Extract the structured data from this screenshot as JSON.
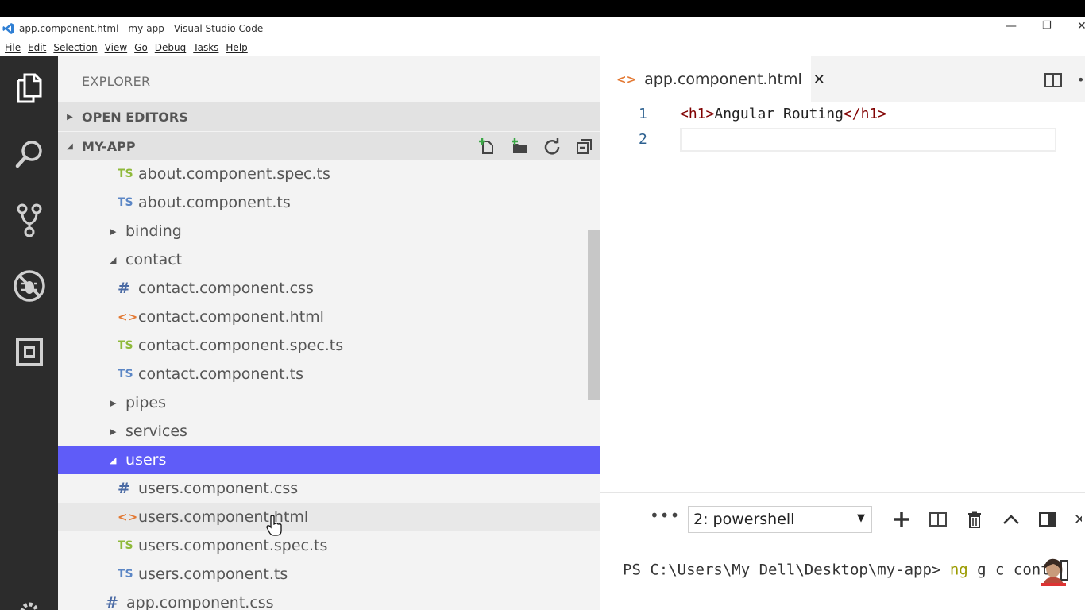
{
  "window": {
    "title": "app.component.html - my-app - Visual Studio Code",
    "minimize": "—",
    "restore": "❐",
    "close": "✕"
  },
  "menu": [
    "File",
    "Edit",
    "Selection",
    "View",
    "Go",
    "Debug",
    "Tasks",
    "Help"
  ],
  "sidebar": {
    "title": "EXPLORER",
    "open_editors": "OPEN EDITORS",
    "project": "MY-APP",
    "tree": [
      {
        "label": "about.component.spec.ts",
        "icon": "TS",
        "kind": "spec",
        "indent": 2
      },
      {
        "label": "about.component.ts",
        "icon": "TS",
        "kind": "ts",
        "indent": 2
      },
      {
        "label": "binding",
        "icon": "▶",
        "kind": "folder-closed",
        "indent": 1
      },
      {
        "label": "contact",
        "icon": "◢",
        "kind": "folder-open",
        "indent": 1
      },
      {
        "label": "contact.component.css",
        "icon": "#",
        "kind": "css",
        "indent": 2
      },
      {
        "label": "contact.component.html",
        "icon": "<>",
        "kind": "html",
        "indent": 2
      },
      {
        "label": "contact.component.spec.ts",
        "icon": "TS",
        "kind": "spec",
        "indent": 2
      },
      {
        "label": "contact.component.ts",
        "icon": "TS",
        "kind": "ts",
        "indent": 2
      },
      {
        "label": "pipes",
        "icon": "▶",
        "kind": "folder-closed",
        "indent": 1
      },
      {
        "label": "services",
        "icon": "▶",
        "kind": "folder-closed",
        "indent": 1
      },
      {
        "label": "users",
        "icon": "◢",
        "kind": "folder-open",
        "indent": 1,
        "selected": true
      },
      {
        "label": "users.component.css",
        "icon": "#",
        "kind": "css",
        "indent": 2
      },
      {
        "label": "users.component.html",
        "icon": "<>",
        "kind": "html",
        "indent": 2,
        "hover": true
      },
      {
        "label": "users.component.spec.ts",
        "icon": "TS",
        "kind": "spec",
        "indent": 2
      },
      {
        "label": "users.component.ts",
        "icon": "TS",
        "kind": "ts",
        "indent": 2
      },
      {
        "label": "app.component.css",
        "icon": "#",
        "kind": "css",
        "indent": 0
      }
    ]
  },
  "editor": {
    "tab_icon": "<>",
    "tab_label": "app.component.html",
    "tab_close": "✕",
    "line_numbers": [
      "1",
      "2"
    ],
    "line1": {
      "open_tag": "<h1>",
      "text": "Angular Routing",
      "close_tag": "</h1>"
    }
  },
  "panel": {
    "more": "•••",
    "terminal_select": "2: powershell",
    "dropdown_arrow": "▼",
    "prompt": "PS C:\\Users\\My Dell\\Desktop\\my-app> ",
    "command": "ng",
    "args": " g c conta"
  },
  "colors": {
    "selection": "#5f5cf8",
    "activitybar": "#2c2c2c",
    "sidebar": "#f3f3f3",
    "tag": "#800000",
    "ts_icon": "#5b86c5",
    "spec_icon": "#8fb93b",
    "html_icon": "#e37933"
  }
}
